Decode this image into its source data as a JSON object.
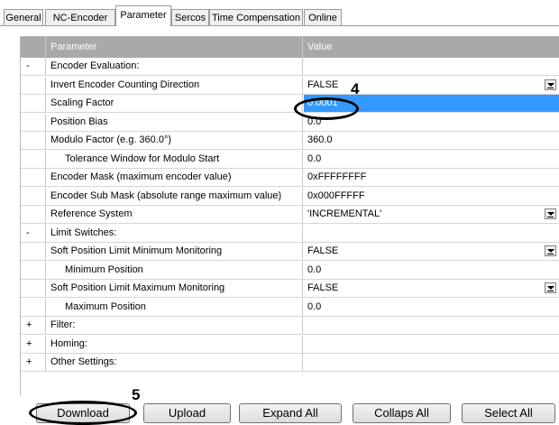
{
  "tabs": [
    {
      "label": "General",
      "active": false
    },
    {
      "label": "NC-Encoder",
      "active": false
    },
    {
      "label": "Parameter",
      "active": true
    },
    {
      "label": "Sercos",
      "active": false
    },
    {
      "label": "Time Compensation",
      "active": false
    },
    {
      "label": "Online",
      "active": false
    }
  ],
  "grid": {
    "header": {
      "param": "Parameter",
      "value": "Value"
    },
    "rows": [
      {
        "marker": "-",
        "param": "Encoder Evaluation:",
        "value": "",
        "dropdown": false
      },
      {
        "marker": "",
        "param": "Invert Encoder Counting Direction",
        "value": "FALSE",
        "dropdown": true
      },
      {
        "marker": "",
        "param": "Scaling Factor",
        "value": "0.0001",
        "dropdown": false,
        "selected": true
      },
      {
        "marker": "",
        "param": "Position Bias",
        "value": "0.0",
        "dropdown": false
      },
      {
        "marker": "",
        "param": "Modulo Factor (e.g. 360.0°)",
        "value": "360.0",
        "dropdown": false
      },
      {
        "marker": "",
        "param": "Tolerance Window for Modulo Start",
        "value": "0.0",
        "dropdown": false,
        "indent": true
      },
      {
        "marker": "",
        "param": "Encoder Mask (maximum encoder value)",
        "value": "0xFFFFFFFF",
        "dropdown": false
      },
      {
        "marker": "",
        "param": "Encoder Sub Mask (absolute range maximum value)",
        "value": "0x000FFFFF",
        "dropdown": false
      },
      {
        "marker": "",
        "param": "Reference System",
        "value": "'INCREMENTAL'",
        "dropdown": true
      },
      {
        "marker": "-",
        "param": "Limit Switches:",
        "value": "",
        "dropdown": false
      },
      {
        "marker": "",
        "param": "Soft Position Limit Minimum Monitoring",
        "value": "FALSE",
        "dropdown": true
      },
      {
        "marker": "",
        "param": "Minimum Position",
        "value": "0.0",
        "dropdown": false,
        "indent": true
      },
      {
        "marker": "",
        "param": "Soft Position Limit Maximum Monitoring",
        "value": "FALSE",
        "dropdown": true
      },
      {
        "marker": "",
        "param": "Maximum Position",
        "value": "0.0",
        "dropdown": false,
        "indent": true
      },
      {
        "marker": "+",
        "param": "Filter:",
        "value": "",
        "dropdown": false
      },
      {
        "marker": "+",
        "param": "Homing:",
        "value": "",
        "dropdown": false
      },
      {
        "marker": "+",
        "param": "Other Settings:",
        "value": "",
        "dropdown": false
      }
    ]
  },
  "annotations": {
    "scaling": "4",
    "download": "5"
  },
  "buttons": {
    "download": "Download",
    "upload": "Upload",
    "expand_all": "Expand All",
    "collaps_all": "Collaps All",
    "select_all": "Select All"
  },
  "colors": {
    "header_bg": "#a9a9a9",
    "selection": "#3399ff",
    "grid_line": "#d5d5d5"
  }
}
